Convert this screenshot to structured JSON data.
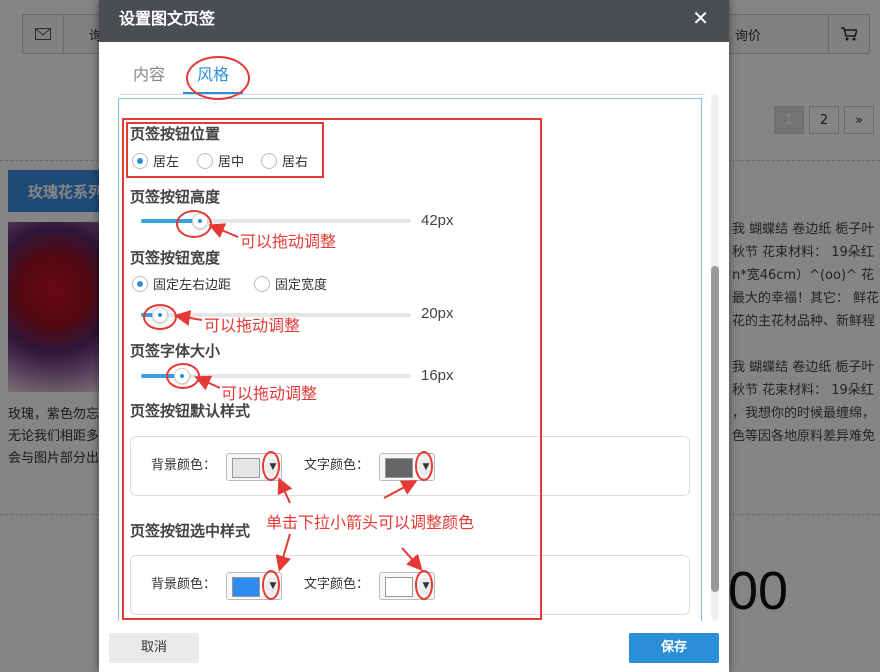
{
  "background": {
    "toolbar": {
      "mail_icon": "mail-icon",
      "inquire_left_label": "询",
      "inquire_right_label": "询价",
      "cart_icon": "cart-icon"
    },
    "pagination": {
      "pages": [
        "1",
        "2"
      ],
      "next_label": "»",
      "current": "1"
    },
    "category_tab_label": "玫瑰花系列",
    "left_text_lines": [
      "玫瑰，紫色勿忘",
      "无论我们相距多",
      "会与图片部分出"
    ],
    "right_text_lines_1": [
      "我 蝴蝶结 卷边纸 栀子叶",
      "秋节 花束材料： 19朵红",
      "n*宽46cm）^(oo)^ 花",
      "最大的幸福！其它： 鲜花",
      "花的主花材品种、新鲜程"
    ],
    "right_text_lines_2": [
      "我 蝴蝶结 卷边纸 栀子叶",
      "秋节 花束材料： 19朵红",
      "，我想你的时候最缠绵，",
      "色等因各地原料差异难免"
    ],
    "big_digits": "00"
  },
  "dialog": {
    "title": "设置图文页签",
    "close_label": "✕",
    "tabs": [
      "内容",
      "风格"
    ],
    "active_tab": "风格",
    "position": {
      "label": "页签按钮位置",
      "options": [
        "居左",
        "居中",
        "居右"
      ],
      "selected": "居左"
    },
    "height": {
      "label": "页签按钮高度",
      "value": "42px",
      "fraction": 0.22
    },
    "width": {
      "label": "页签按钮宽度",
      "options": [
        "固定左右边距",
        "固定宽度"
      ],
      "selected": "固定左右边距",
      "value": "20px",
      "fraction": 0.07
    },
    "font_size": {
      "label": "页签字体大小",
      "value": "16px",
      "fraction": 0.15
    },
    "default_style": {
      "label": "页签按钮默认样式",
      "bg_label": "背景颜色：",
      "text_label": "文字颜色：",
      "bg_color": "#e6e6e6",
      "text_color": "#666666"
    },
    "selected_style": {
      "label": "页签按钮选中样式",
      "bg_label": "背景颜色：",
      "text_label": "文字颜色：",
      "bg_color": "#2e8bf0",
      "text_color": "#ffffff"
    },
    "cancel_label": "取消",
    "save_label": "保存"
  },
  "annotations": {
    "drag_hint": "可以拖动调整",
    "color_hint": "单击下拉小箭头可以调整颜色",
    "color": "#e53935"
  }
}
